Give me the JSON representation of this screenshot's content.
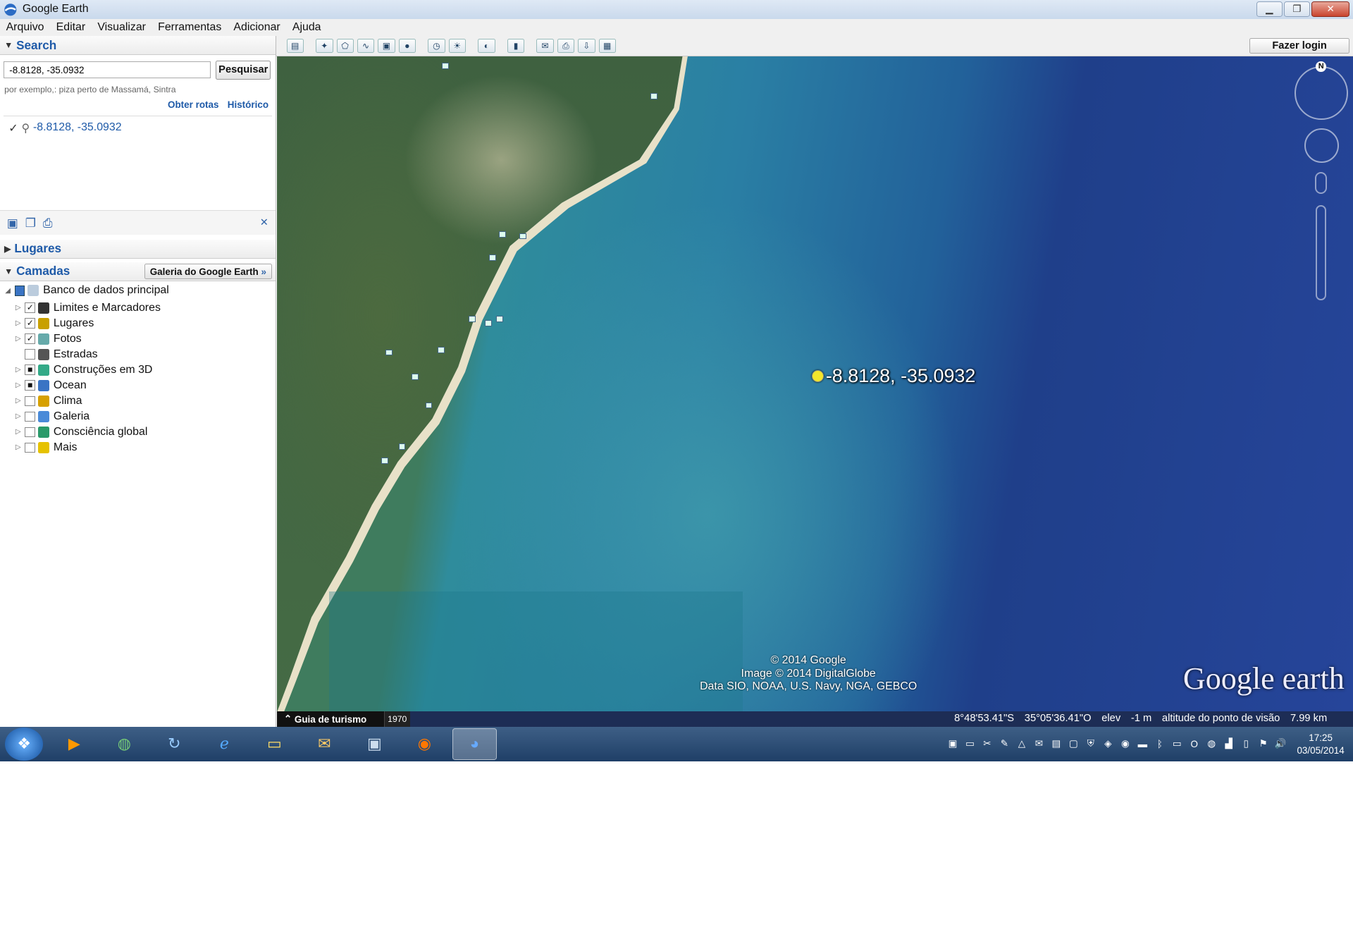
{
  "window": {
    "title": "Google Earth"
  },
  "menu": [
    "Arquivo",
    "Editar",
    "Visualizar",
    "Ferramentas",
    "Adicionar",
    "Ajuda"
  ],
  "toolbar": {
    "login": "Fazer login"
  },
  "search": {
    "header": "Search",
    "value": "-8.8128, -35.0932",
    "button": "Pesquisar",
    "hint": "por exemplo,: piza perto de Massamá, Sintra",
    "link_routes": "Obter rotas",
    "link_history": "Histórico",
    "result": "-8.8128, -35.0932"
  },
  "places": {
    "header": "Lugares"
  },
  "layers": {
    "header": "Camadas",
    "gallery_button": "Galeria do Google Earth",
    "root": "Banco de dados principal",
    "items": [
      {
        "label": "Limites e Marcadores",
        "checked": "✓",
        "color": "#333"
      },
      {
        "label": "Lugares",
        "checked": "✓",
        "color": "#c8a000"
      },
      {
        "label": "Fotos",
        "checked": "✓",
        "color": "#6aa"
      },
      {
        "label": "Estradas",
        "checked": "",
        "color": "#555"
      },
      {
        "label": "Construções em 3D",
        "checked": "■",
        "color": "#3a8"
      },
      {
        "label": "Ocean",
        "checked": "■",
        "color": "#3a74c4"
      },
      {
        "label": "Clima",
        "checked": "",
        "color": "#d6a000"
      },
      {
        "label": "Galeria",
        "checked": "",
        "color": "#4a8ad8"
      },
      {
        "label": "Consciência global",
        "checked": "",
        "color": "#2a9a6a"
      },
      {
        "label": "Mais",
        "checked": "",
        "color": "#e6c200"
      }
    ]
  },
  "map": {
    "placemark": "-8.8128, -35.0932",
    "copyright_1": "© 2014 Google",
    "copyright_2": "Image © 2014 DigitalGlobe",
    "copyright_3": "Data SIO, NOAA, U.S. Navy, NGA, GEBCO",
    "logo": "Google earth",
    "compass_north": "N"
  },
  "status": {
    "guide": "Guia de turismo",
    "year": "1970",
    "lat": "8°48'53.41\"S",
    "lon": "35°05'36.41\"O",
    "elev_label": "elev",
    "elev": "-1 m",
    "alt_label": "altitude do ponto de visão",
    "alt": "7.99 km"
  },
  "taskbar": {
    "time": "17:25",
    "date": "03/05/2014"
  }
}
